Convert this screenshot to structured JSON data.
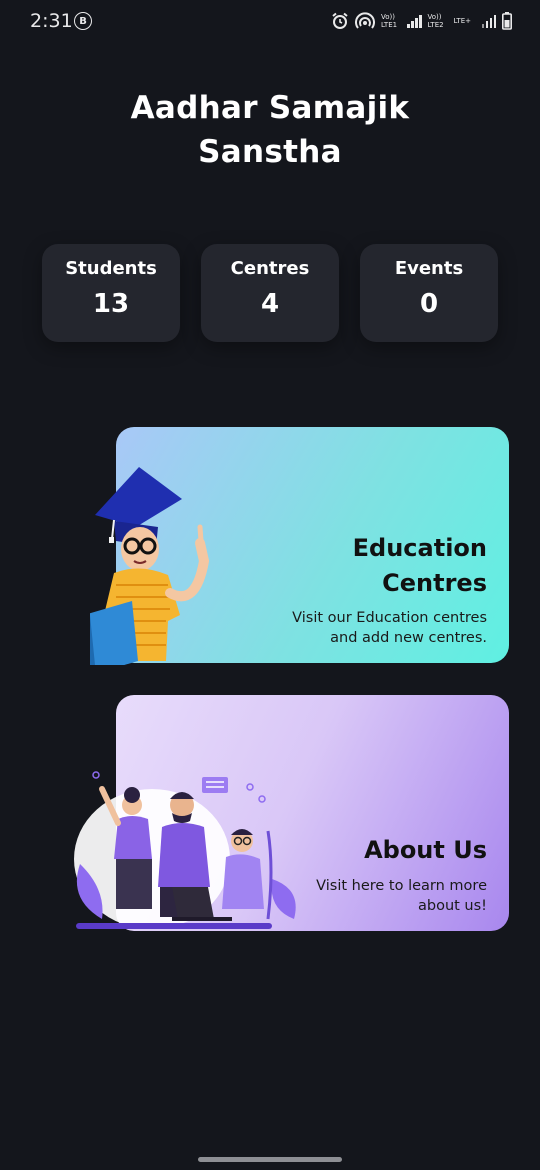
{
  "status": {
    "time": "2:31",
    "badge": "B",
    "sim1": "Vo)) LTE1",
    "sim2": "Vo)) LTE2",
    "lte_plus": "LTE+"
  },
  "title": {
    "line1": "Aadhar Samajik",
    "line2": "Sanstha"
  },
  "stats": [
    {
      "label": "Students",
      "value": "13"
    },
    {
      "label": "Centres",
      "value": "4"
    },
    {
      "label": "Events",
      "value": "0"
    }
  ],
  "cards": {
    "education": {
      "title_line1": "Education",
      "title_line2": "Centres",
      "desc_line1": "Visit our Education centres",
      "desc_line2": "and add new centres."
    },
    "about": {
      "title": "About Us",
      "desc_line1": "Visit here to learn more",
      "desc_line2": "about us!"
    }
  },
  "icons": {
    "alarm": "alarm-icon",
    "hotspot": "hotspot-icon",
    "signal": "signal-icon",
    "battery": "battery-icon"
  },
  "colors": {
    "background": "#14161c",
    "stat_card": "#24262e",
    "edu_gradient_start": "#a9c8f7",
    "edu_gradient_end": "#5ff0e2",
    "about_gradient_start": "#e8dcfb",
    "about_gradient_end": "#a887ee"
  }
}
